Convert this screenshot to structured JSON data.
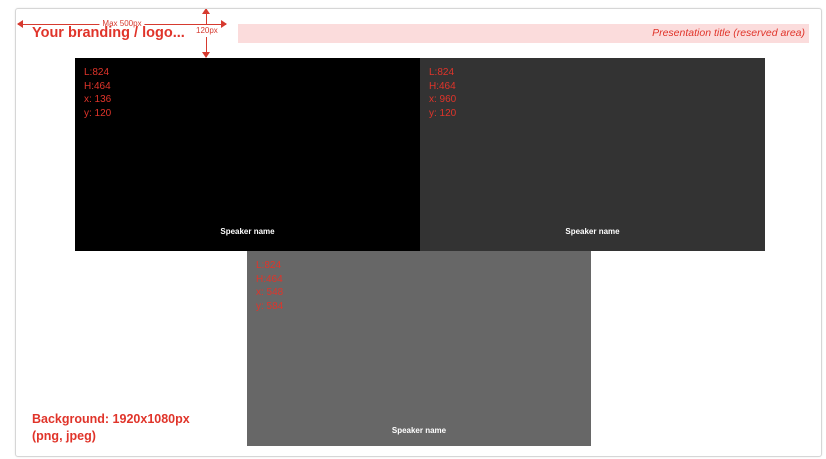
{
  "annotations": {
    "max_width_label": "Max 500px",
    "height_label": "120px",
    "accent_color": "#e0342a"
  },
  "header": {
    "branding": "Your branding / logo...",
    "presentation_title": "Presentation title (reserved area)",
    "title_area_color": "#fbdcdc"
  },
  "tiles": [
    {
      "specs": [
        "L:824",
        "H:464",
        "x: 136",
        "y: 120"
      ],
      "speaker": "Speaker name",
      "color": "#000000"
    },
    {
      "specs": [
        "L:824",
        "H:464",
        "x: 960",
        "y: 120"
      ],
      "speaker": "Speaker name",
      "color": "#333333"
    },
    {
      "specs": [
        "L:824",
        "H:464",
        "x: 548",
        "y: 584"
      ],
      "speaker": "Speaker name",
      "color": "#676767"
    }
  ],
  "footer": {
    "background_line1": "Background: 1920x1080px",
    "background_line2": "(png, jpeg)"
  }
}
